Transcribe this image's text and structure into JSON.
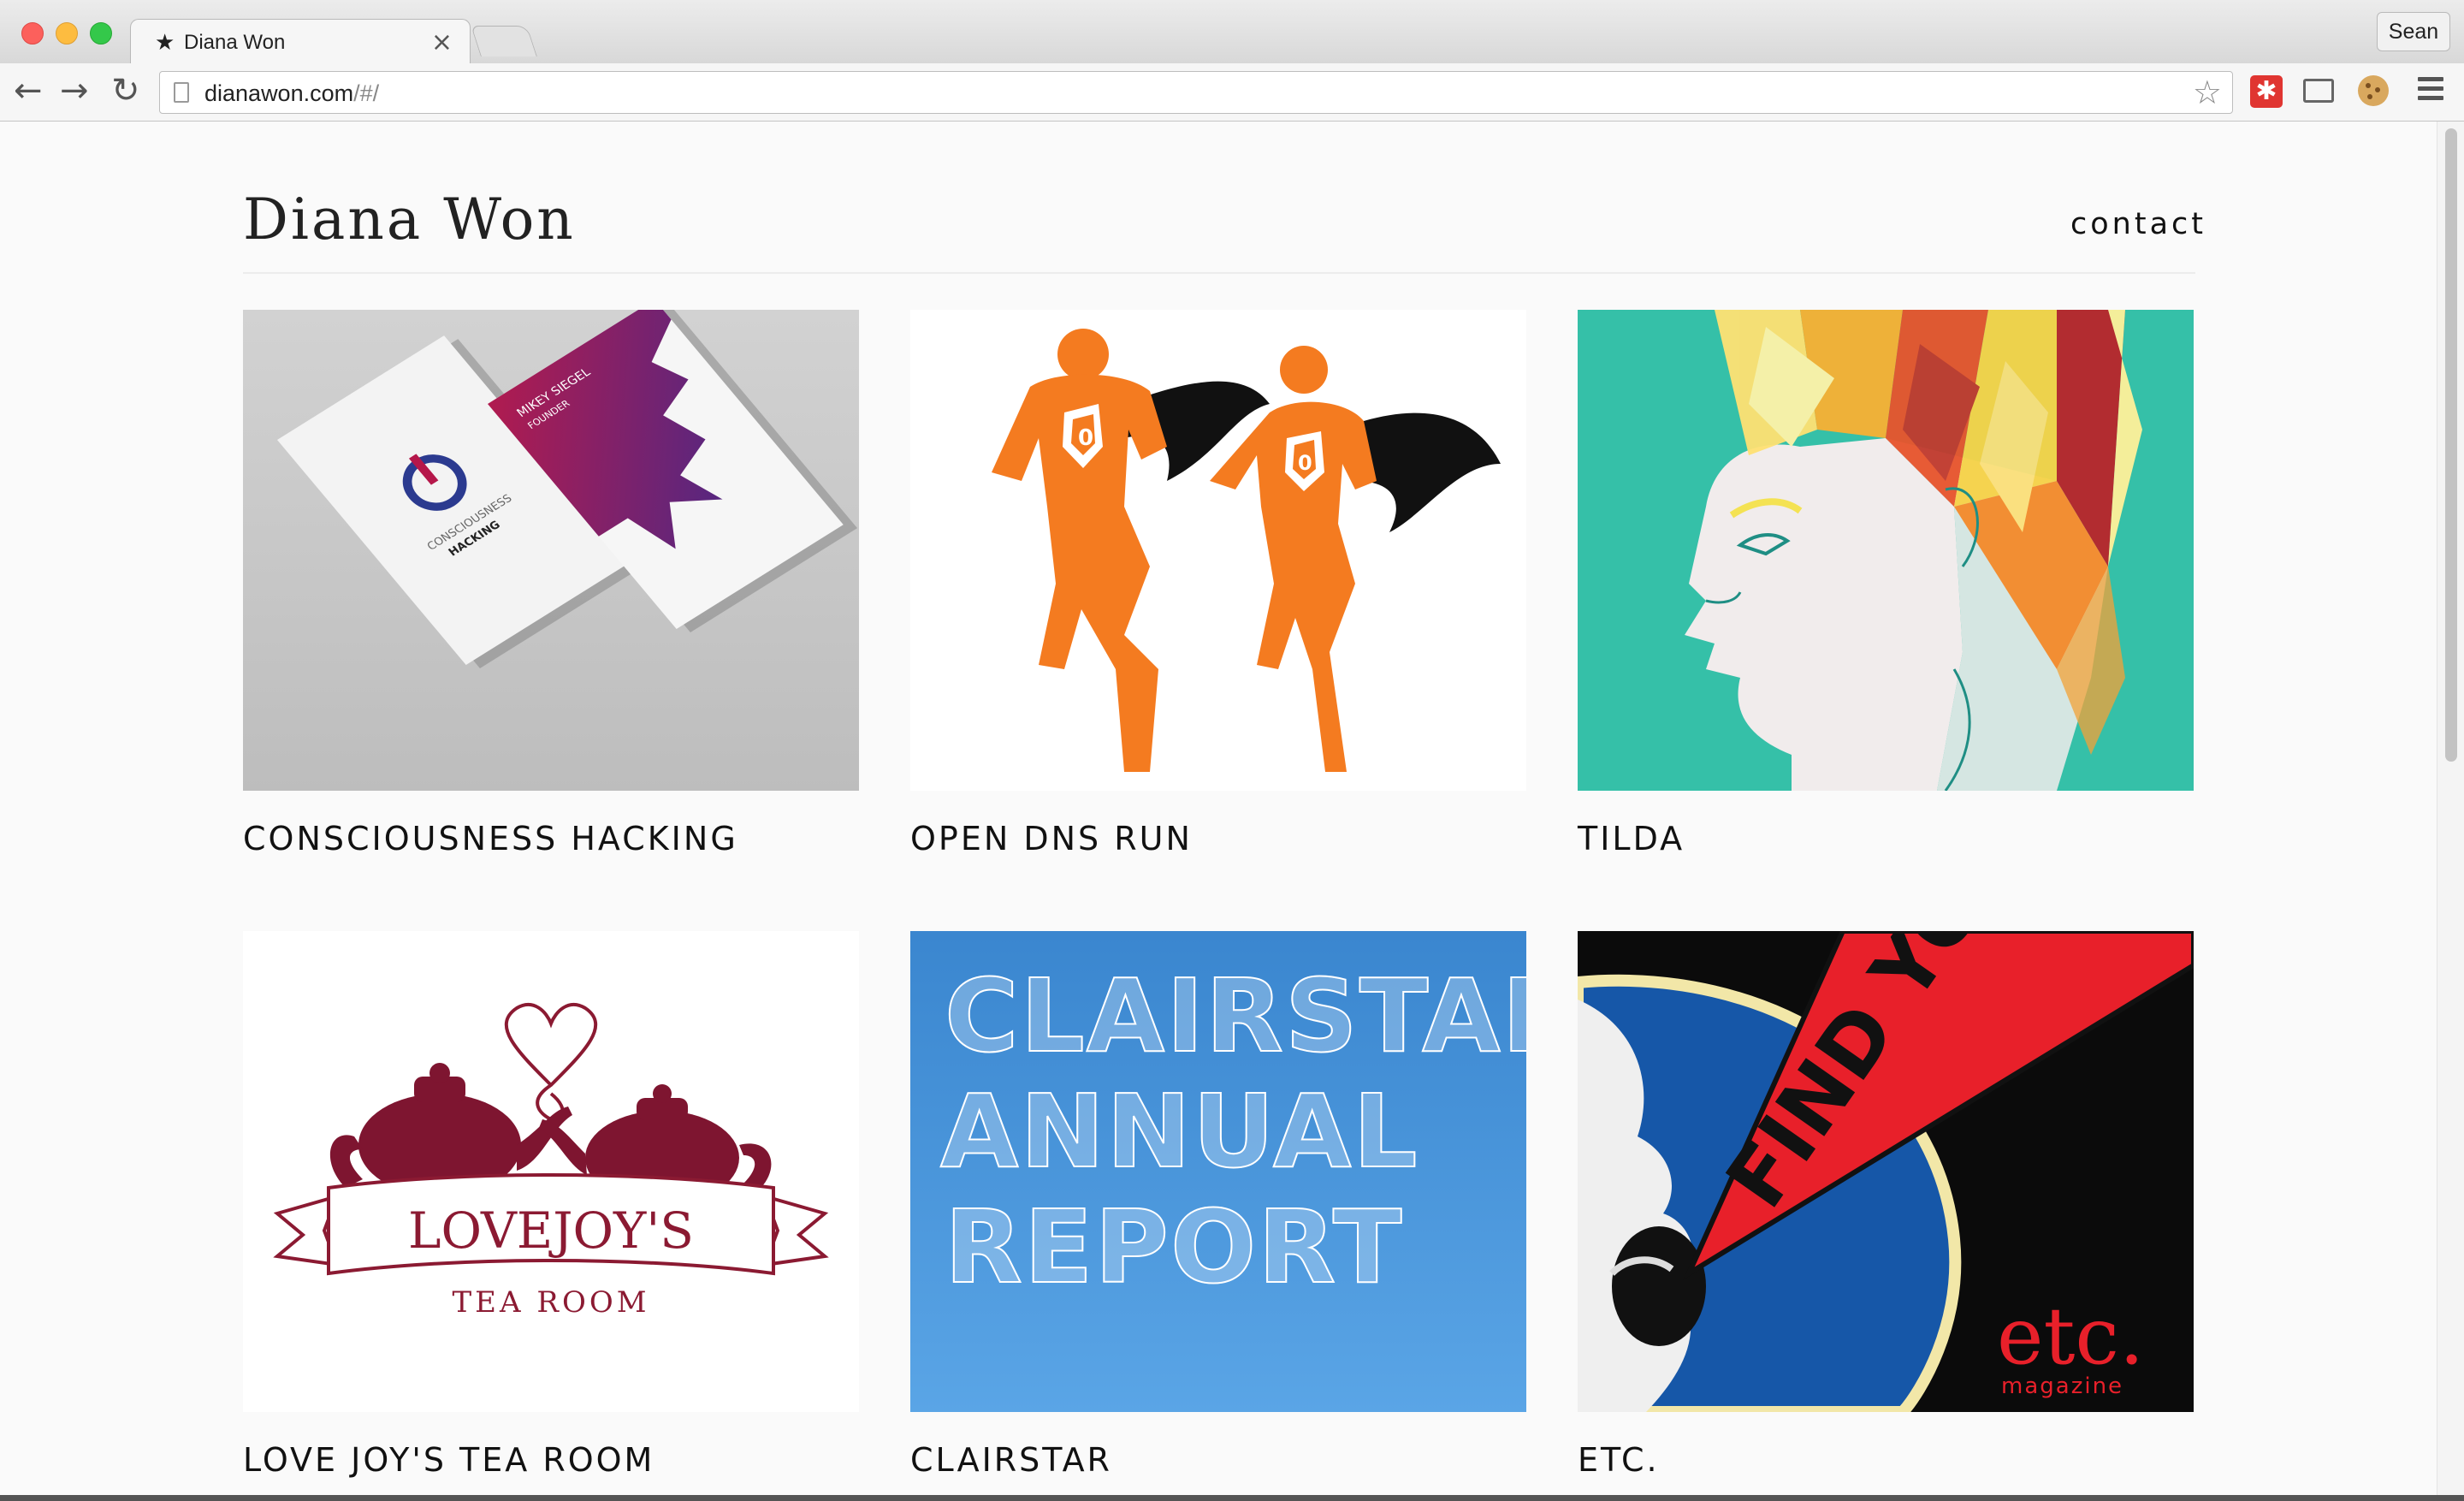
{
  "browser": {
    "tab_title": "Diana Won",
    "tab_close": "×",
    "profile_name": "Sean",
    "url_host": "dianawon.com",
    "url_path": "/#/",
    "extension_symbol": "✱",
    "back_glyph": "←",
    "forward_glyph": "→",
    "reload_glyph": "↻",
    "bookmark_glyph": "☆",
    "tab_star_glyph": "★",
    "icons": [
      "back-arrow-icon",
      "forward-arrow-icon",
      "reload-icon",
      "page-icon",
      "bookmark-star-icon",
      "extension-icon",
      "cast-icon",
      "cookie-icon",
      "menu-icon"
    ]
  },
  "site": {
    "title": "Diana Won",
    "contact_label": "contact"
  },
  "projects": [
    {
      "label": "CONSCIOUSNESS HACKING"
    },
    {
      "label": "OPEN DNS RUN"
    },
    {
      "label": "TILDA"
    },
    {
      "label": "LOVE JOY'S TEA ROOM"
    },
    {
      "label": "CLAIRSTAR"
    },
    {
      "label": "ETC."
    }
  ],
  "artwork_text": {
    "ch_word_1": "CONSCIOUSNESS",
    "ch_word_2": "HACKING",
    "ch_name": "MIKEY SIEGEL",
    "ch_role": "FOUNDER",
    "teaemblem_line1": "LOVEJOY'S",
    "teaemblem_line2": "TEA ROOM",
    "clairstar_line1": "CLAIRSTAR",
    "clairstar_line2": "ANNUAL",
    "clairstar_line3": "REPORT",
    "etc_banner": "FIND YOUR",
    "etc_logo": "etc.",
    "etc_sub": "magazine"
  },
  "colors": {
    "open_dns_orange": "#f47b20",
    "tilda_teal": "#35c0a8",
    "tea_room_maroon": "#8b1a32",
    "clairstar_blue": "#3f8fd6",
    "etc_red": "#e8202a",
    "etc_blue": "#1657a8"
  }
}
